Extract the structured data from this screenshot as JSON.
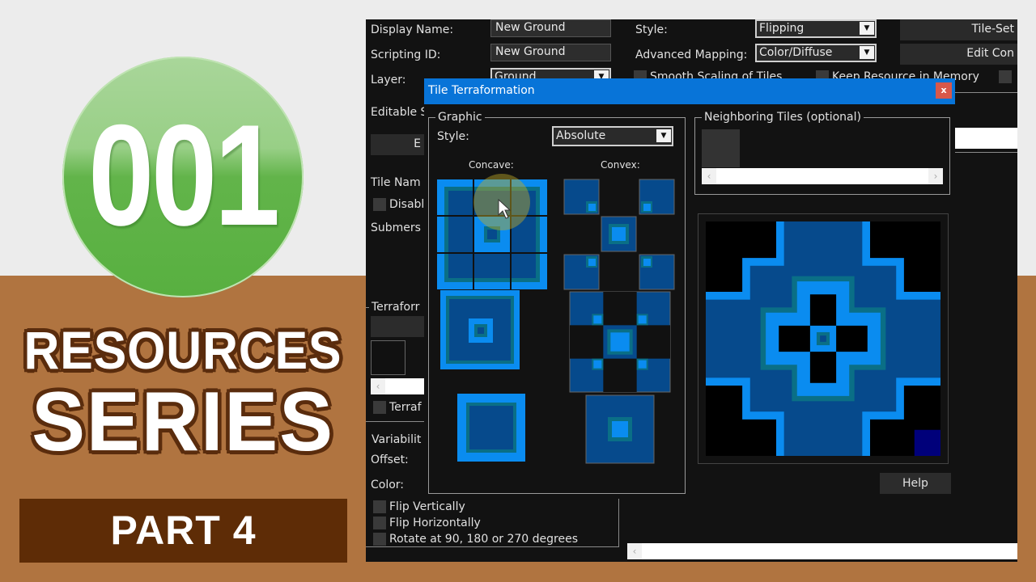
{
  "thumbnail": {
    "badge_number": "001",
    "title_line1": "RESOURCES",
    "title_line2": "SERIES",
    "part_label": "PART 4",
    "colors": {
      "badge_green": "#5ab042",
      "brown_bg": "#b07440",
      "dark_brown": "#5e2c06",
      "light_bg": "#ececec"
    }
  },
  "editor": {
    "display_name_label": "Display Name:",
    "display_name_value": "New Ground",
    "scripting_id_label": "Scripting ID:",
    "scripting_id_value": "New Ground",
    "layer_label": "Layer:",
    "layer_value": "Ground",
    "editable_label": "Editable S",
    "edit_button_partial": "E",
    "tile_name_label": "Tile Nam",
    "disable_checkbox_label": "Disabl",
    "submerse_label": "Submers",
    "terraform_group_label": "Terraforr",
    "terraform_checkbox_label": "Terraf",
    "variability_group_label": "Variabilit",
    "offset_label": "Offset:",
    "color_label": "Color:",
    "flip_vertically_label": "Flip Vertically",
    "flip_horizontally_label": "Flip Horizontally",
    "rotate_label": "Rotate at 90, 180 or 270 degrees",
    "style_label": "Style:",
    "style_value": "Flipping",
    "advanced_mapping_label": "Advanced Mapping:",
    "advanced_mapping_value": "Color/Diffuse",
    "smooth_scaling_label": "Smooth Scaling of Tiles",
    "keep_resource_label": "Keep Resource in Memory",
    "tileset_button": "Tile-Set",
    "edit_con_button": "Edit Con"
  },
  "dialog": {
    "title": "Tile Terraformation",
    "close_label": "x",
    "graphic_group_label": "Graphic",
    "style_label": "Style:",
    "style_value": "Absolute",
    "concave_label": "Concave:",
    "convex_label": "Convex:",
    "neighboring_group_label": "Neighboring Tiles (optional)",
    "help_button": "Help",
    "colors": {
      "titlebar": "#0874d8",
      "tile_light": "#0a8cf0",
      "tile_dark": "#064a8c",
      "tile_teal": "#0a6f86",
      "tile_navy": "#00007a"
    }
  }
}
